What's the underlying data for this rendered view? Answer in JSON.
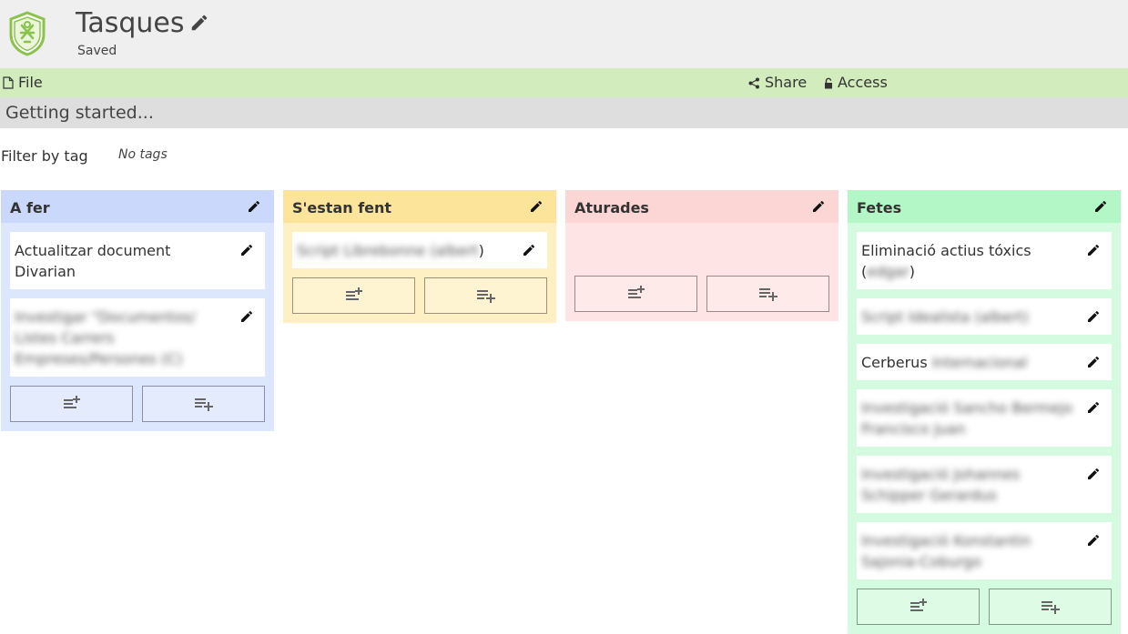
{
  "app": {
    "title": "Tasques",
    "status": "Saved"
  },
  "toolbar": {
    "file_label": "File",
    "share_label": "Share",
    "access_label": "Access"
  },
  "notice": "Getting started...",
  "filter": {
    "label": "Filter by tag",
    "value": "No tags"
  },
  "colors": {
    "todo": "#c9d8fb",
    "doing": "#fde49b",
    "stopped": "#fcd5d5",
    "done": "#b3f7c6",
    "toolbar": "#d3ecbe",
    "logo": "#8bc34a"
  },
  "columns": [
    {
      "title": "A fer",
      "cards": [
        {
          "text": "Actualitzar document Divarian",
          "suffix": ""
        },
        {
          "text": "",
          "blurred": "Investigar \"Documentos/ Listes Carrers Empreses/Persones (C)",
          "suffix": ""
        }
      ]
    },
    {
      "title": "S'estan fent",
      "cards": [
        {
          "text": "",
          "blurred": "Script Librebonne (albert",
          "suffix": ")"
        }
      ]
    },
    {
      "title": "Aturades",
      "cards": []
    },
    {
      "title": "Fetes",
      "cards": [
        {
          "text": "Eliminació actius tóxics (",
          "blurred": "edgar",
          "suffix": ")"
        },
        {
          "text": "",
          "blurred": "Script Idealista (albert)",
          "suffix": ""
        },
        {
          "text": "Cerberus ",
          "blurred": "Internacional",
          "suffix": ""
        },
        {
          "text": "",
          "blurred": "Investigació Sancho Bermejo Francisco Juan",
          "suffix": ""
        },
        {
          "text": "",
          "blurred": "Investigació Johannes Schipper Gerardus",
          "suffix": ""
        },
        {
          "text": "",
          "blurred": "Investigació Konstantin Sajonia-Coburgo",
          "suffix": ""
        }
      ]
    }
  ],
  "icons": {
    "logo": "shield-logo-icon",
    "edit": "pencil-icon",
    "file": "file-icon",
    "share": "share-icon",
    "access": "lock-icon",
    "add_top": "playlist-add-top-icon",
    "add_bottom": "playlist-add-icon"
  }
}
